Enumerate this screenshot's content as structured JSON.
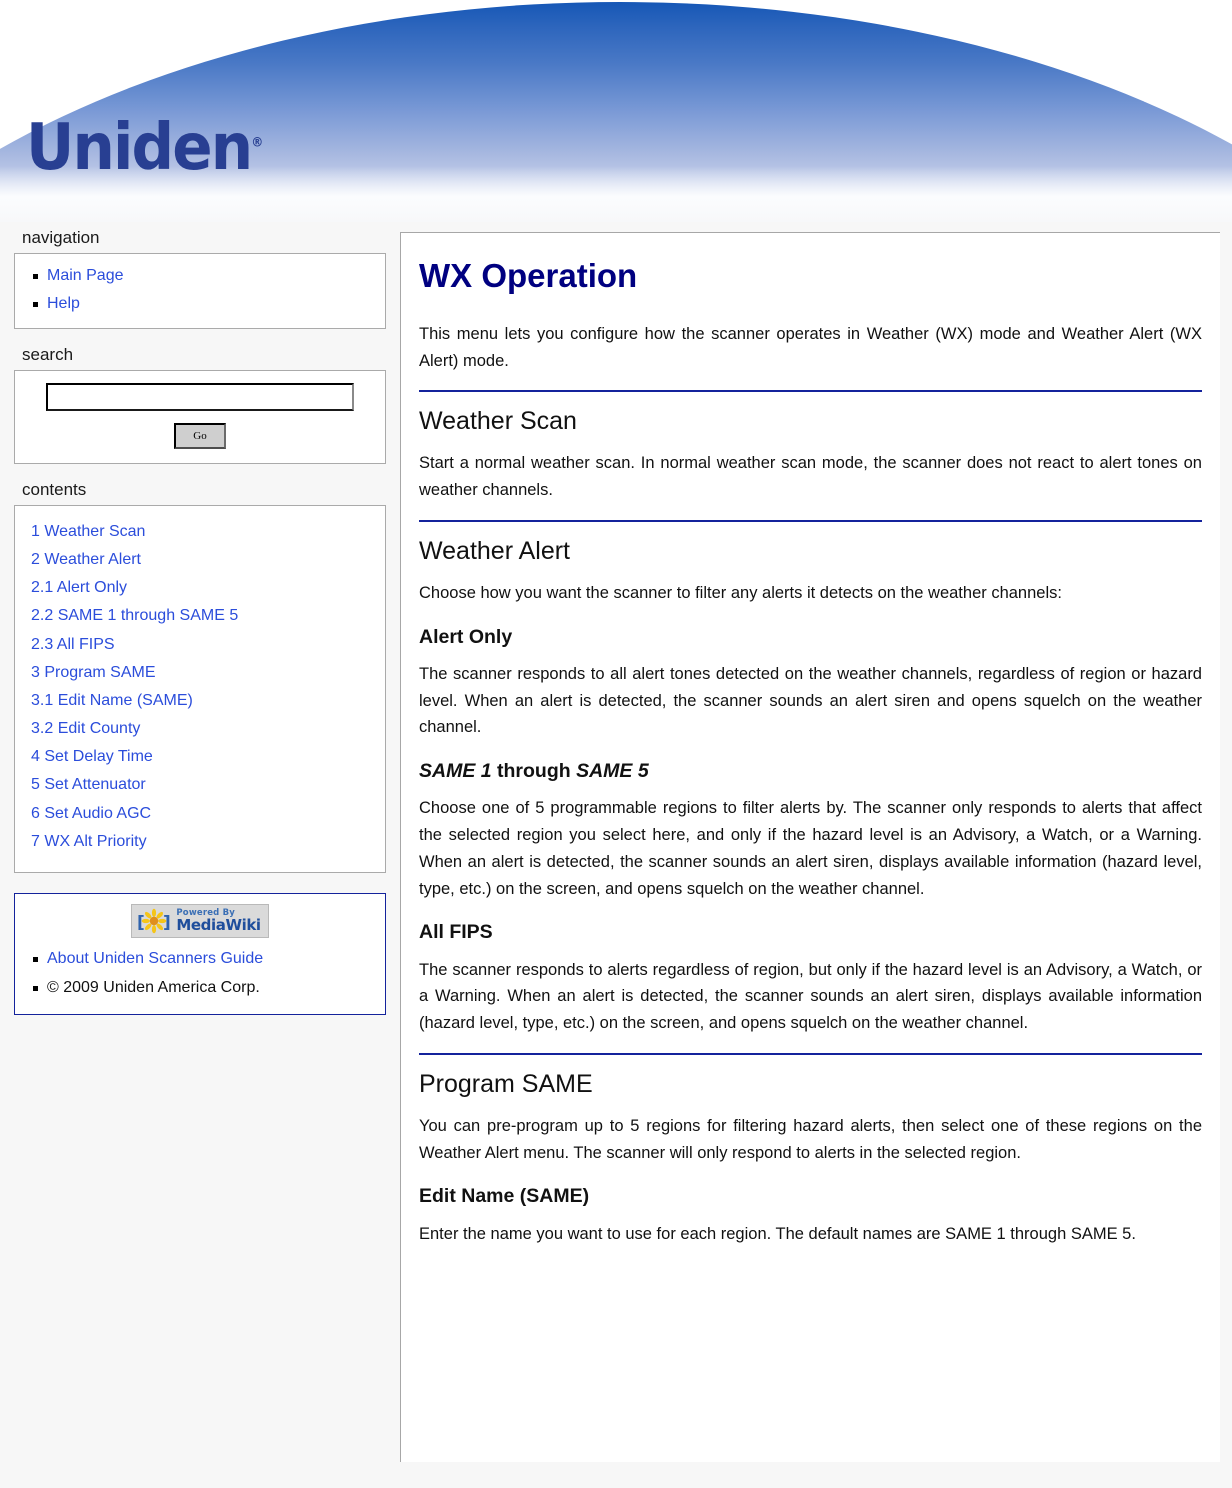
{
  "site": {
    "logo_text": "Uniden",
    "logo_trademark": "®"
  },
  "sidebar": {
    "navigation": {
      "title": "navigation",
      "items": [
        {
          "label": "Main Page"
        },
        {
          "label": "Help"
        }
      ]
    },
    "search": {
      "title": "search",
      "value": "",
      "placeholder": "",
      "go_label": "Go"
    },
    "contents": {
      "title": "contents",
      "items": [
        {
          "label": "1 Weather Scan"
        },
        {
          "label": "2 Weather Alert"
        },
        {
          "label": "2.1 Alert Only"
        },
        {
          "label": "2.2 SAME 1 through SAME 5"
        },
        {
          "label": "2.3 All FIPS"
        },
        {
          "label": "3 Program SAME"
        },
        {
          "label": "3.1 Edit Name (SAME)"
        },
        {
          "label": "3.2 Edit County"
        },
        {
          "label": "4 Set Delay Time"
        },
        {
          "label": "5 Set Attenuator"
        },
        {
          "label": "6 Set Audio AGC"
        },
        {
          "label": "7 WX Alt Priority"
        }
      ]
    },
    "footer": {
      "badge": {
        "powered_by": "Powered By",
        "name": "MediaWiki",
        "bracket_left": "[",
        "bracket_right": "]"
      },
      "items": [
        {
          "label": "About Uniden Scanners Guide",
          "link": true
        },
        {
          "label": "© 2009 Uniden America Corp.",
          "link": false
        }
      ]
    }
  },
  "main": {
    "title": "WX Operation",
    "intro": "This menu lets you configure how the scanner operates in Weather (WX) mode and Weather Alert (WX Alert) mode.",
    "sections": {
      "weather_scan": {
        "heading": "Weather Scan",
        "body": "Start a normal weather scan. In normal weather scan mode, the scanner does not react to alert tones on weather channels."
      },
      "weather_alert": {
        "heading": "Weather Alert",
        "body": "Choose how you want the scanner to filter any alerts it detects on the weather channels:"
      },
      "alert_only": {
        "heading": "Alert Only",
        "body": "The scanner responds to all alert tones detected on the weather channels, regardless of region or hazard level. When an alert is detected, the scanner sounds an alert siren and opens squelch on the weather channel."
      },
      "same_range": {
        "heading_part1": "SAME 1",
        "heading_part2": "through",
        "heading_part3": "SAME 5",
        "body": "Choose one of 5 programmable regions to filter alerts by. The scanner only responds to alerts that affect the selected region you select here, and only if the hazard level is an Advisory, a Watch, or a Warning. When an alert is detected, the scanner sounds an alert siren, displays available information (hazard level, type, etc.) on the screen, and opens squelch on the weather channel."
      },
      "all_fips": {
        "heading": "All FIPS",
        "body": "The scanner responds to alerts regardless of region, but only if the hazard level is an Advisory, a Watch, or a Warning. When an alert is detected, the scanner sounds an alert siren, displays available information (hazard level, type, etc.) on the screen, and opens squelch on the weather channel."
      },
      "program_same": {
        "heading": "Program SAME",
        "body": "You can pre-program up to 5 regions for filtering hazard alerts, then select one of these regions on the Weather Alert menu. The scanner will only respond to alerts in the selected region."
      },
      "edit_name": {
        "heading": "Edit Name (SAME)",
        "body": "Enter the name you want to use for each region. The default names are SAME 1 through SAME 5."
      }
    }
  },
  "colors": {
    "title_navy": "#000080",
    "rule_navy": "#14239c",
    "link_blue": "#2b4ddb",
    "banner_blue": "#1657b6",
    "logo_blue": "#283f92"
  }
}
